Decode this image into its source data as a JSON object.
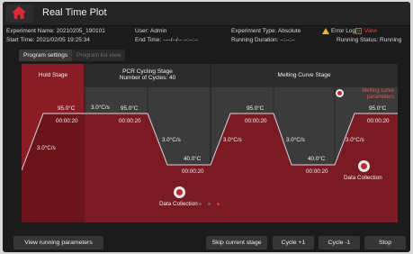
{
  "app": {
    "title": "Real Time Plot"
  },
  "info": {
    "experiment_name": "Experiment Name: 20210205_190101",
    "start_time": "Start Time: 2021/02/05 19:25:34",
    "user": "User: Admin",
    "end_time": "End Time: ----/--/-- --:--:--",
    "experiment_type": "Experiment Type: Absolute",
    "running_duration": "Running Duration: --:--:--",
    "error_log_label": "Error Log:",
    "error_log_link": "View",
    "running_status": "Running Status: Running"
  },
  "tabs": [
    {
      "label": "Program settings",
      "active": true
    },
    {
      "label": "Program list view",
      "active": false
    }
  ],
  "stages": {
    "hold": {
      "title": "Hold Stage"
    },
    "pcr": {
      "title": "PCR Cycling Stage",
      "cycles": "Number of Cycles: 40"
    },
    "melt": {
      "title": "Melting Curve Stage",
      "params_link_line1": "Melting curve",
      "params_link_line2": "parameters"
    }
  },
  "plot": {
    "hold_rate": "3.0°C/s",
    "hold_temp": "95.0°C",
    "hold_time": "00:00:20",
    "pcr_rate_1": "3.0°C/s",
    "pcr_temp_1": "95.0°C",
    "pcr_time_1": "00:00:20",
    "pcr_rate_2": "3.0°C/s",
    "pcr_temp_2": "40.0°C",
    "pcr_time_2": "00:00:20",
    "pcr_collect": "Data Collection",
    "melt_rate_1": "3.0°C/s",
    "melt_temp_1": "95.0°C",
    "melt_time_1": "00:00:20",
    "melt_rate_2": "3.0°C/s",
    "melt_temp_2": "40.0°C",
    "melt_time_2": "00:00:20",
    "melt_rate_3": "3.0°C/s",
    "melt_temp_3": "95.0°C",
    "melt_time_3": "00:00:20",
    "melt_collect": "Data Collection"
  },
  "pager": {
    "pages": 3,
    "current": 3
  },
  "buttons": {
    "view_params": "View running parameters",
    "skip_stage": "Skip current stage",
    "cycle_plus": "Cycle +1",
    "cycle_minus": "Cycle -1",
    "stop": "Stop"
  },
  "colors": {
    "accent": "#c0282f",
    "fill": "#7a1a22",
    "hold_bg": "#8a1c25"
  }
}
